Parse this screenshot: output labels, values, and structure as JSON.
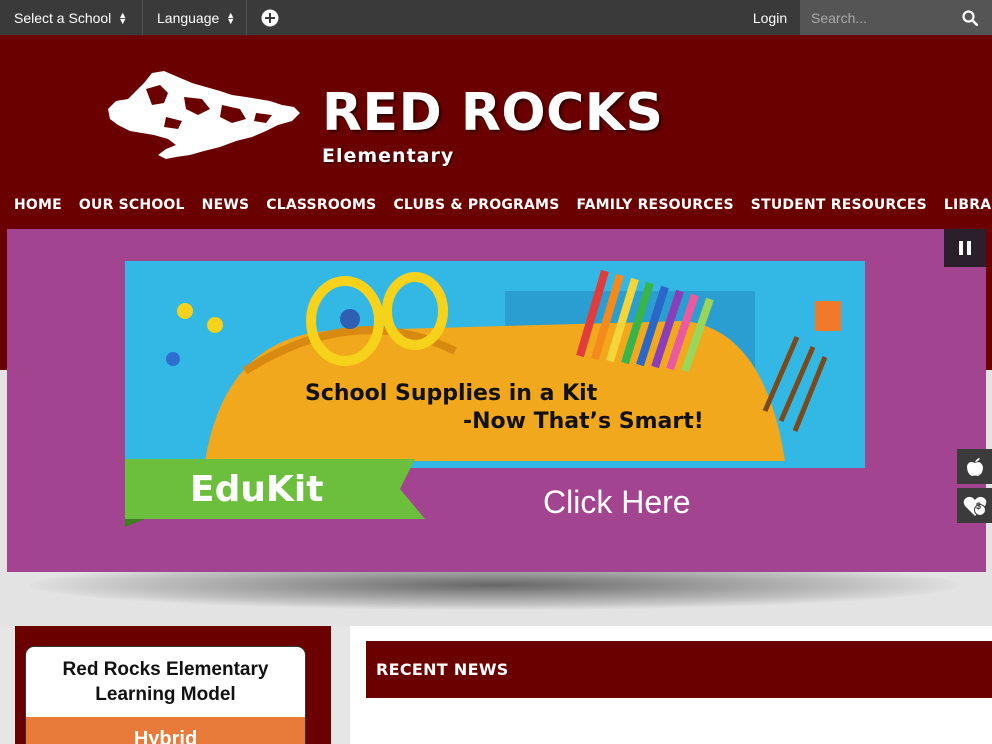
{
  "topbar": {
    "select_school": "Select a School",
    "language": "Language",
    "login": "Login",
    "search_placeholder": "Search..."
  },
  "header": {
    "title": "RED ROCKS",
    "subtitle": "Elementary"
  },
  "nav": {
    "items": [
      {
        "label": "HOME"
      },
      {
        "label": "OUR SCHOOL"
      },
      {
        "label": "NEWS"
      },
      {
        "label": "CLASSROOMS"
      },
      {
        "label": "CLUBS & PROGRAMS"
      },
      {
        "label": "FAMILY RESOURCES"
      },
      {
        "label": "STUDENT RESOURCES"
      },
      {
        "label": "LIBRARY"
      }
    ]
  },
  "banner": {
    "headline_1": "School Supplies in a Kit",
    "headline_2": "-Now That’s Smart!",
    "brand": "EduKit",
    "cta": "Click Here"
  },
  "side_icons": {
    "heart_badge": "$"
  },
  "learning_model": {
    "title_line1": "Red Rocks Elementary",
    "title_line2": "Learning Model",
    "status": "Hybrid"
  },
  "recent_news": {
    "heading": "RECENT NEWS"
  },
  "colors": {
    "brand_maroon": "#6b0000",
    "topbar": "#3a3a3a",
    "banner_purple": "#a2448f",
    "hybrid_orange": "#e87b3a"
  }
}
